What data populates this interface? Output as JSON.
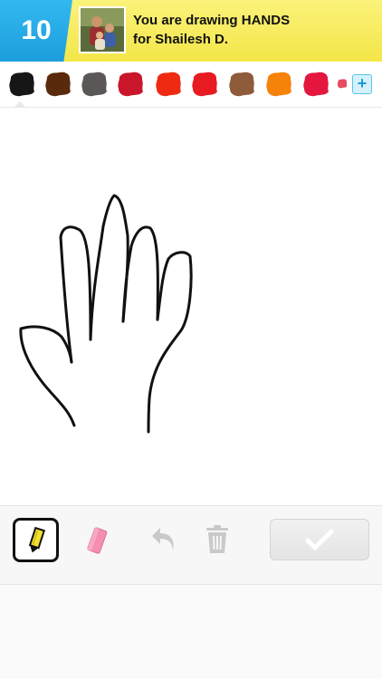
{
  "header": {
    "round": "10",
    "line1": "You are drawing HANDS",
    "line2": "for Shailesh D."
  },
  "palette": {
    "colors": [
      "#161616",
      "#5a2a0c",
      "#5c5757",
      "#c9162b",
      "#ee2b12",
      "#e81b22",
      "#8e5b3b",
      "#f6820a",
      "#e4173f",
      "#e94b63"
    ],
    "selected_index": 0,
    "add_button_icon": "plus-icon",
    "add_button_symbol": "+"
  },
  "canvas": {
    "stroke_color": "#111111",
    "drawing_subject": "hand outline"
  },
  "toolbar": {
    "tools": [
      "pencil-icon",
      "eraser-icon",
      "undo-icon",
      "trash-icon"
    ],
    "active_tool": "pencil",
    "pencil_color": "#f2e030",
    "eraser_color": "#f48fb1",
    "done_icon": "checkmark-icon"
  }
}
